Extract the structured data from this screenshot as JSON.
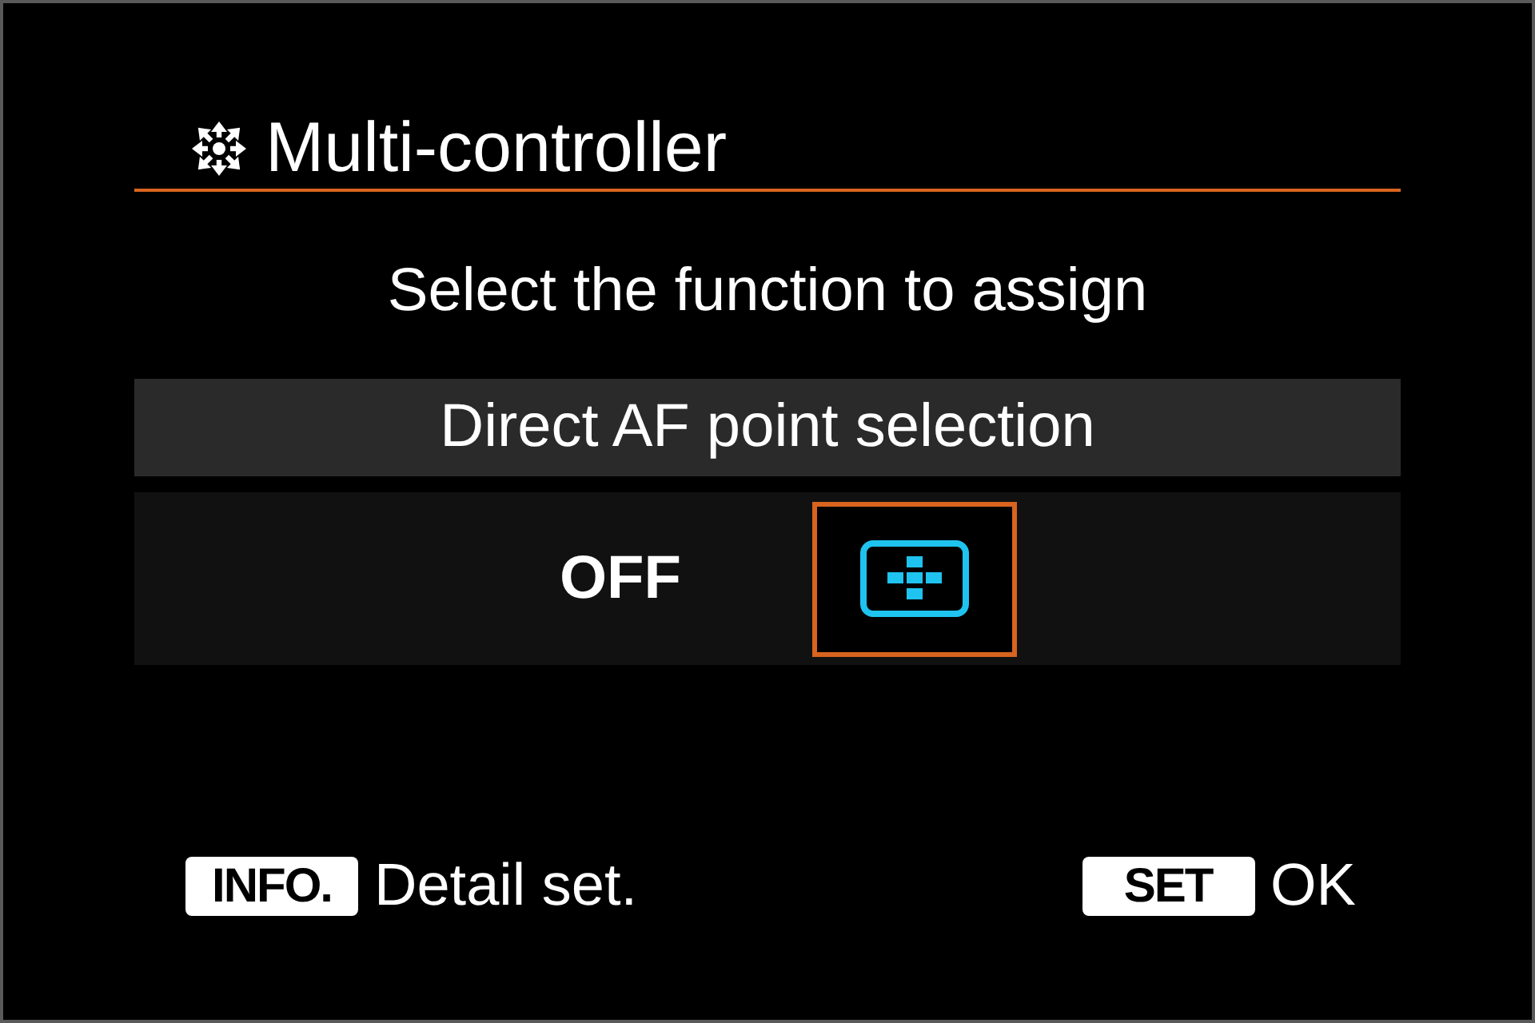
{
  "screen": {
    "title": "Multi-controller"
  },
  "prompt": "Select the function to assign",
  "function": {
    "label": "Direct AF point selection"
  },
  "options": [
    {
      "kind": "text",
      "label": "OFF",
      "selected": false
    },
    {
      "kind": "af_points",
      "selected": true
    }
  ],
  "footer": [
    {
      "key": "INFO.",
      "action": "Detail set."
    },
    {
      "key": "SET",
      "action": "OK"
    }
  ]
}
